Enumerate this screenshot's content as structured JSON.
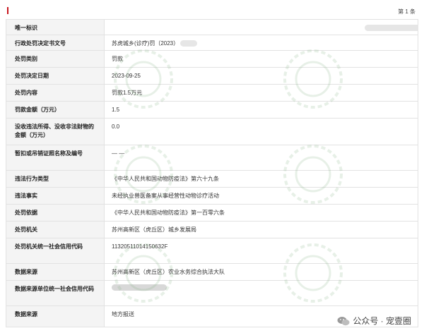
{
  "header": {
    "page_number": "第 1 条"
  },
  "rows": [
    {
      "label": "唯一标识",
      "value": ""
    },
    {
      "label": "行政处罚决定书文号",
      "value": "苏虎城乡(诊疗)罚（2023）"
    },
    {
      "label": "处罚类别",
      "value": "罚款"
    },
    {
      "label": "处罚决定日期",
      "value": "2023-09-25"
    },
    {
      "label": "处罚内容",
      "value": "罚款1.5万元"
    },
    {
      "label": "罚款金额（万元）",
      "value": "1.5"
    },
    {
      "label": "没收违法所得、没收非法财物的金额（万元）",
      "value": "0.0"
    },
    {
      "label": "暂扣或吊销证照名称及编号",
      "value": "— —"
    },
    {
      "label": "违法行为类型",
      "value": "《中华人民共和国动物防疫法》第六十九条"
    },
    {
      "label": "违法事实",
      "value": "未经执业兽医备案从事经营性动物诊疗活动"
    },
    {
      "label": "处罚依据",
      "value": "《中华人民共和国动物防疫法》第一百零六条"
    },
    {
      "label": "处罚机关",
      "value": "苏州高新区（虎丘区）城乡发展局"
    },
    {
      "label": "处罚机关统一社会信用代码",
      "value": "11320511014150632F"
    },
    {
      "label": "数据来源",
      "value": "苏州高新区（虎丘区）农业水务综合执法大队"
    },
    {
      "label": "数据来源单位统一社会信用代码",
      "value": ""
    },
    {
      "label": "数据来源",
      "value": "地方报送"
    }
  ],
  "footer": {
    "account_label": "公众号 · 宠壹圈"
  },
  "colors": {
    "accent_red": "#c8161d",
    "label_bg": "#f4f4f4",
    "border": "#e2e2e2",
    "watermark_green": "#6a9a6a"
  }
}
